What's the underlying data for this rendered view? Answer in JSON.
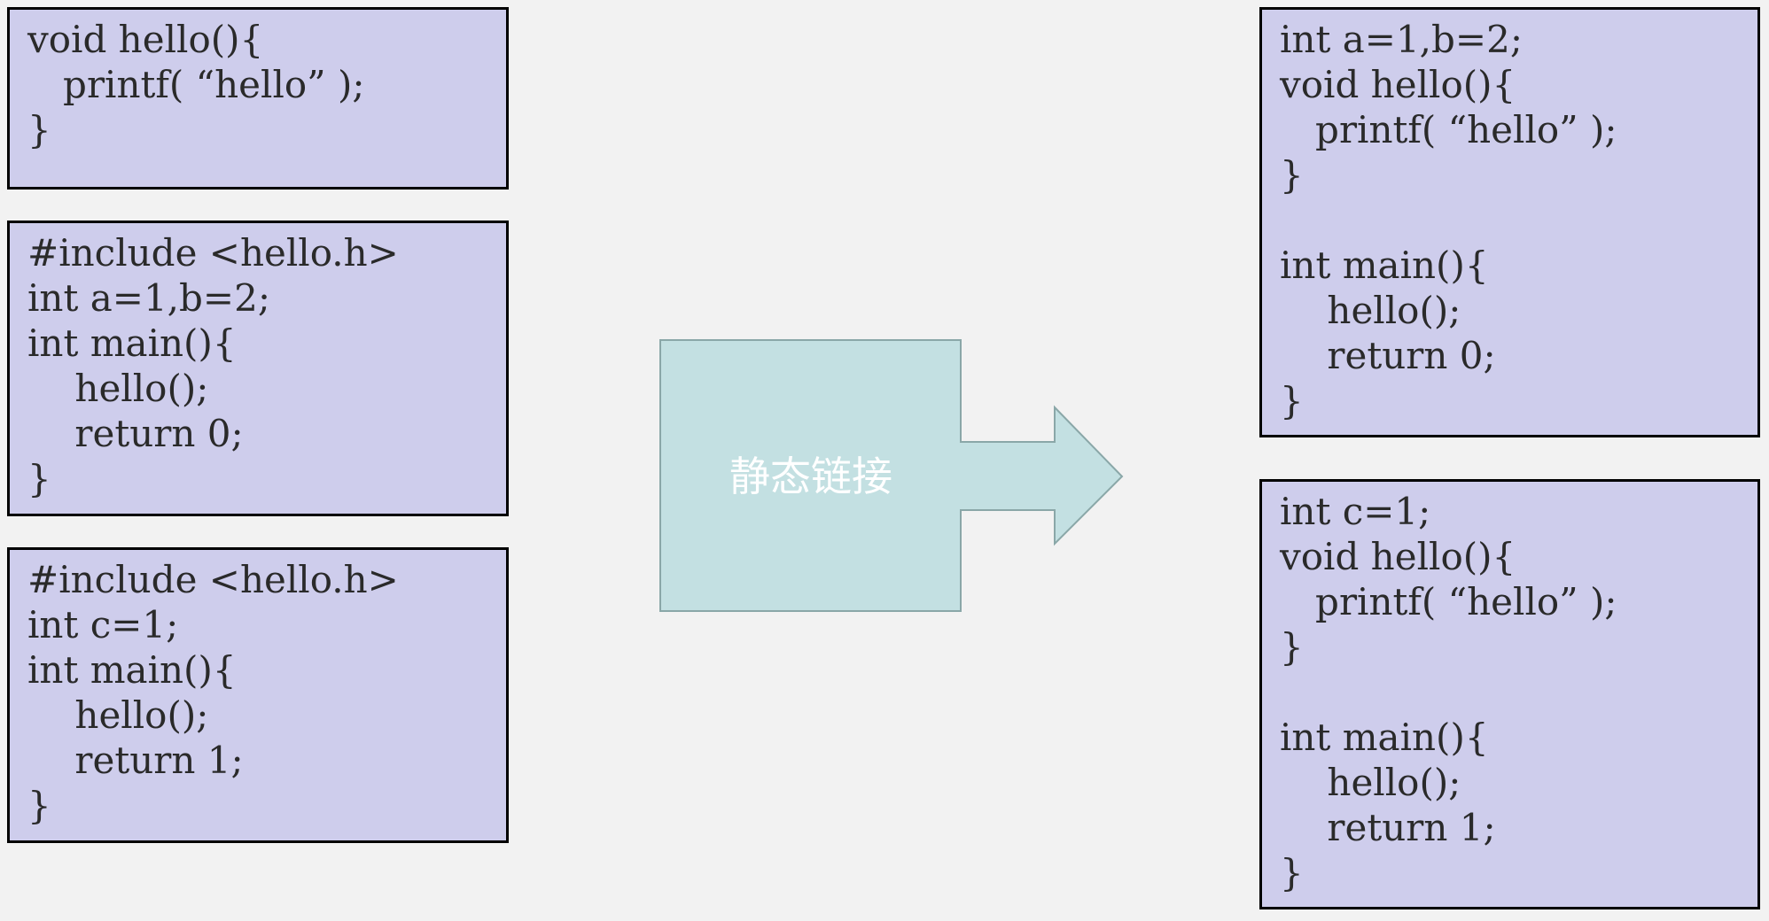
{
  "colors": {
    "background": "#f2f2f2",
    "code_box_fill": "#cecdec",
    "code_box_border": "#000000",
    "code_text": "#2a2a2a",
    "arrow_fill": "#c3e0e2",
    "arrow_stroke": "#8aa7a8",
    "arrow_label": "#ffffff"
  },
  "source_files": [
    {
      "lines": [
        "void hello(){",
        "   printf( “hello” );",
        "}"
      ]
    },
    {
      "lines": [
        "#include <hello.h>",
        "int a=1,b=2;",
        "int main(){",
        "    hello();",
        "    return 0;",
        "}"
      ]
    },
    {
      "lines": [
        "#include <hello.h>",
        "int c=1;",
        "int main(){",
        "    hello();",
        "    return 1;",
        "}"
      ]
    }
  ],
  "arrow": {
    "label": "静态链接",
    "icon": "right-block-arrow-icon"
  },
  "linked_outputs": [
    {
      "lines": [
        "int a=1,b=2;",
        "void hello(){",
        "   printf( “hello” );",
        "}",
        "",
        "int main(){",
        "    hello();",
        "    return 0;",
        "}"
      ]
    },
    {
      "lines": [
        "int c=1;",
        "void hello(){",
        "   printf( “hello” );",
        "}",
        "",
        "int main(){",
        "    hello();",
        "    return 1;",
        "}"
      ]
    }
  ]
}
